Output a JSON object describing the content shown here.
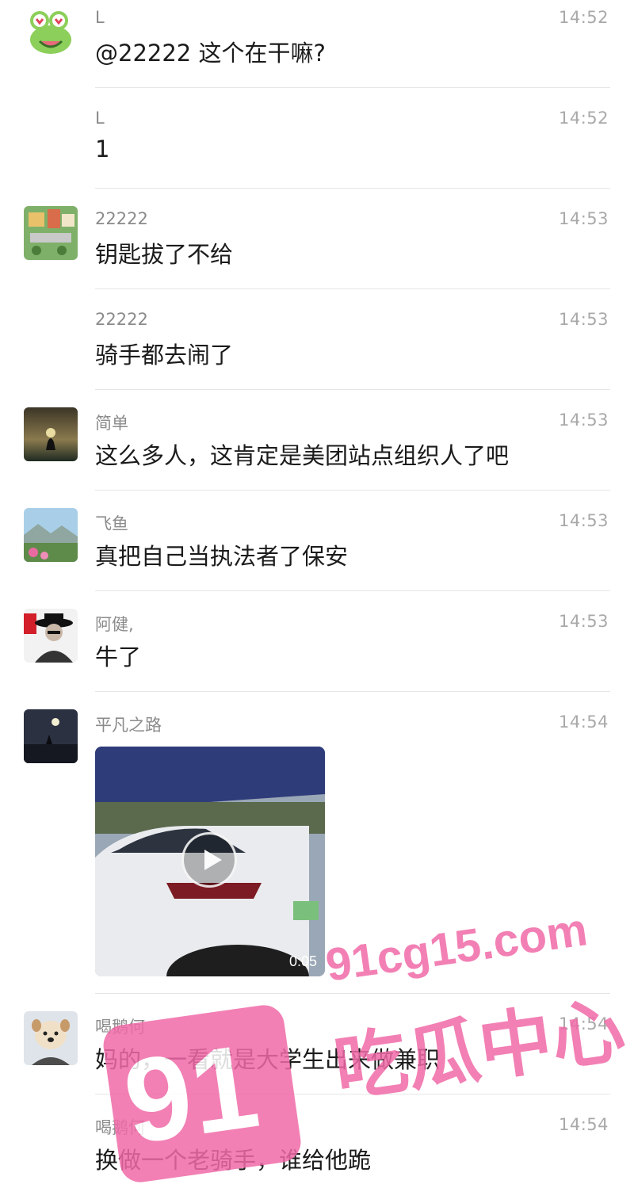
{
  "messages": [
    {
      "sender": "L",
      "time": "14:52",
      "text": "@22222 这个在干嘛?",
      "avatar": "frog-avatar"
    },
    {
      "sender": "L",
      "time": "14:52",
      "text": "1"
    },
    {
      "sender": "22222",
      "time": "14:53",
      "text": "钥匙拔了不给",
      "avatar": "cartoon-town-avatar"
    },
    {
      "sender": "22222",
      "time": "14:53",
      "text": "骑手都去闹了"
    },
    {
      "sender": "简单",
      "time": "14:53",
      "text": "这么多人，这肯定是美团站点组织人了吧",
      "avatar": "sunset-silhouette-avatar"
    },
    {
      "sender": "飞鱼",
      "time": "14:53",
      "text": "真把自己当执法者了保安",
      "avatar": "landscape-avatar"
    },
    {
      "sender": "阿健,",
      "time": "14:53",
      "text": "牛了",
      "avatar": "man-in-hat-avatar"
    },
    {
      "sender": "平凡之路",
      "time": "14:54",
      "video_duration": "0:05",
      "avatar": "night-road-avatar"
    },
    {
      "sender": "喝鹅何",
      "time": "14:54",
      "text": "妈的，一看就是大学生出来做兼职",
      "avatar": "dog-avatar"
    },
    {
      "sender": "喝鹅何",
      "time": "14:54",
      "text": "换做一个老骑手，谁给他跪"
    }
  ],
  "watermark": {
    "url": "91cg15.com",
    "number": "91",
    "label": "吃瓜中心"
  },
  "colors": {
    "watermark": "#f06aa8",
    "name": "#8b8b8b",
    "time": "#a9a9a9",
    "text": "#1b1b1b"
  }
}
